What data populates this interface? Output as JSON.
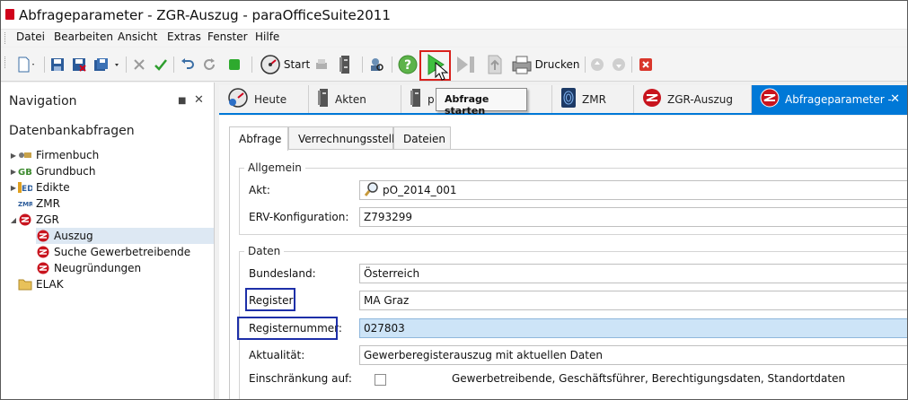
{
  "window": {
    "title": "Abfrageparameter - ZGR-Auszug - paraOfficeSuite2011"
  },
  "menu": {
    "items": [
      "Datei",
      "Bearbeiten",
      "Ansicht",
      "Extras",
      "Fenster",
      "Hilfe"
    ]
  },
  "toolbar": {
    "start_label": "Start",
    "print_label": "Drucken",
    "tooltip": "Abfrage starten"
  },
  "navigation": {
    "title": "Navigation",
    "section": "Datenbankabfragen",
    "tree": [
      {
        "label": "Firmenbuch",
        "icon": "firmenbuch-icon",
        "level": 0,
        "expander": "collapsed"
      },
      {
        "label": "Grundbuch",
        "icon": "grundbuch-icon",
        "level": 0,
        "expander": "collapsed"
      },
      {
        "label": "Edikte",
        "icon": "edikte-icon",
        "level": 0,
        "expander": "collapsed"
      },
      {
        "label": "ZMR",
        "icon": "zmr-icon",
        "level": 0,
        "expander": "none"
      },
      {
        "label": "ZGR",
        "icon": "zgr-icon",
        "level": 0,
        "expander": "expanded"
      },
      {
        "label": "Auszug",
        "icon": "zgr-icon",
        "level": 1,
        "expander": "none",
        "selected": true
      },
      {
        "label": "Suche Gewerbetreibende",
        "icon": "zgr-icon",
        "level": 1,
        "expander": "none"
      },
      {
        "label": "Neugründungen",
        "icon": "zgr-icon",
        "level": 1,
        "expander": "none"
      },
      {
        "label": "ELAK",
        "icon": "folder-icon",
        "level": 0,
        "expander": "none"
      }
    ]
  },
  "doc_tabs": [
    {
      "label": "Heute",
      "icon": "speedometer-icon"
    },
    {
      "label": "Akten",
      "icon": "file-cabinet-icon"
    },
    {
      "label": "p",
      "icon": "file-cabinet-icon"
    },
    {
      "label": "ZMR",
      "icon": "fingerprint-icon"
    },
    {
      "label": "ZGR-Auszug",
      "icon": "zgr-icon"
    },
    {
      "label": "Abfrageparameter -",
      "icon": "zgr-icon",
      "active": true
    }
  ],
  "inner_tabs": [
    "Abfrage",
    "Verrechnungsstelle",
    "Dateien"
  ],
  "form": {
    "allgemein": {
      "title": "Allgemein",
      "akt_label": "Akt:",
      "akt_value": "pO_2014_001",
      "erv_label": "ERV-Konfiguration:",
      "erv_value": "Z793299"
    },
    "daten": {
      "title": "Daten",
      "bundesland_label": "Bundesland:",
      "bundesland_value": "Österreich",
      "register_label": "Register:",
      "register_value": "MA Graz",
      "registernummer_label": "Registernummer:",
      "registernummer_value": "027803",
      "aktualitaet_label": "Aktualität:",
      "aktualitaet_value": "Gewerberegisterauszug mit aktuellen Daten",
      "einschraenkung_label": "Einschränkung auf:",
      "einschraenkung_text": "Gewerbetreibende, Geschäftsführer, Berechtigungsdaten, Standortdaten"
    }
  },
  "colors": {
    "accent": "#0078d7",
    "highlight_red": "#d9201c",
    "annotation_blue": "#1d2fa8",
    "selected_field": "#cde4f7"
  }
}
